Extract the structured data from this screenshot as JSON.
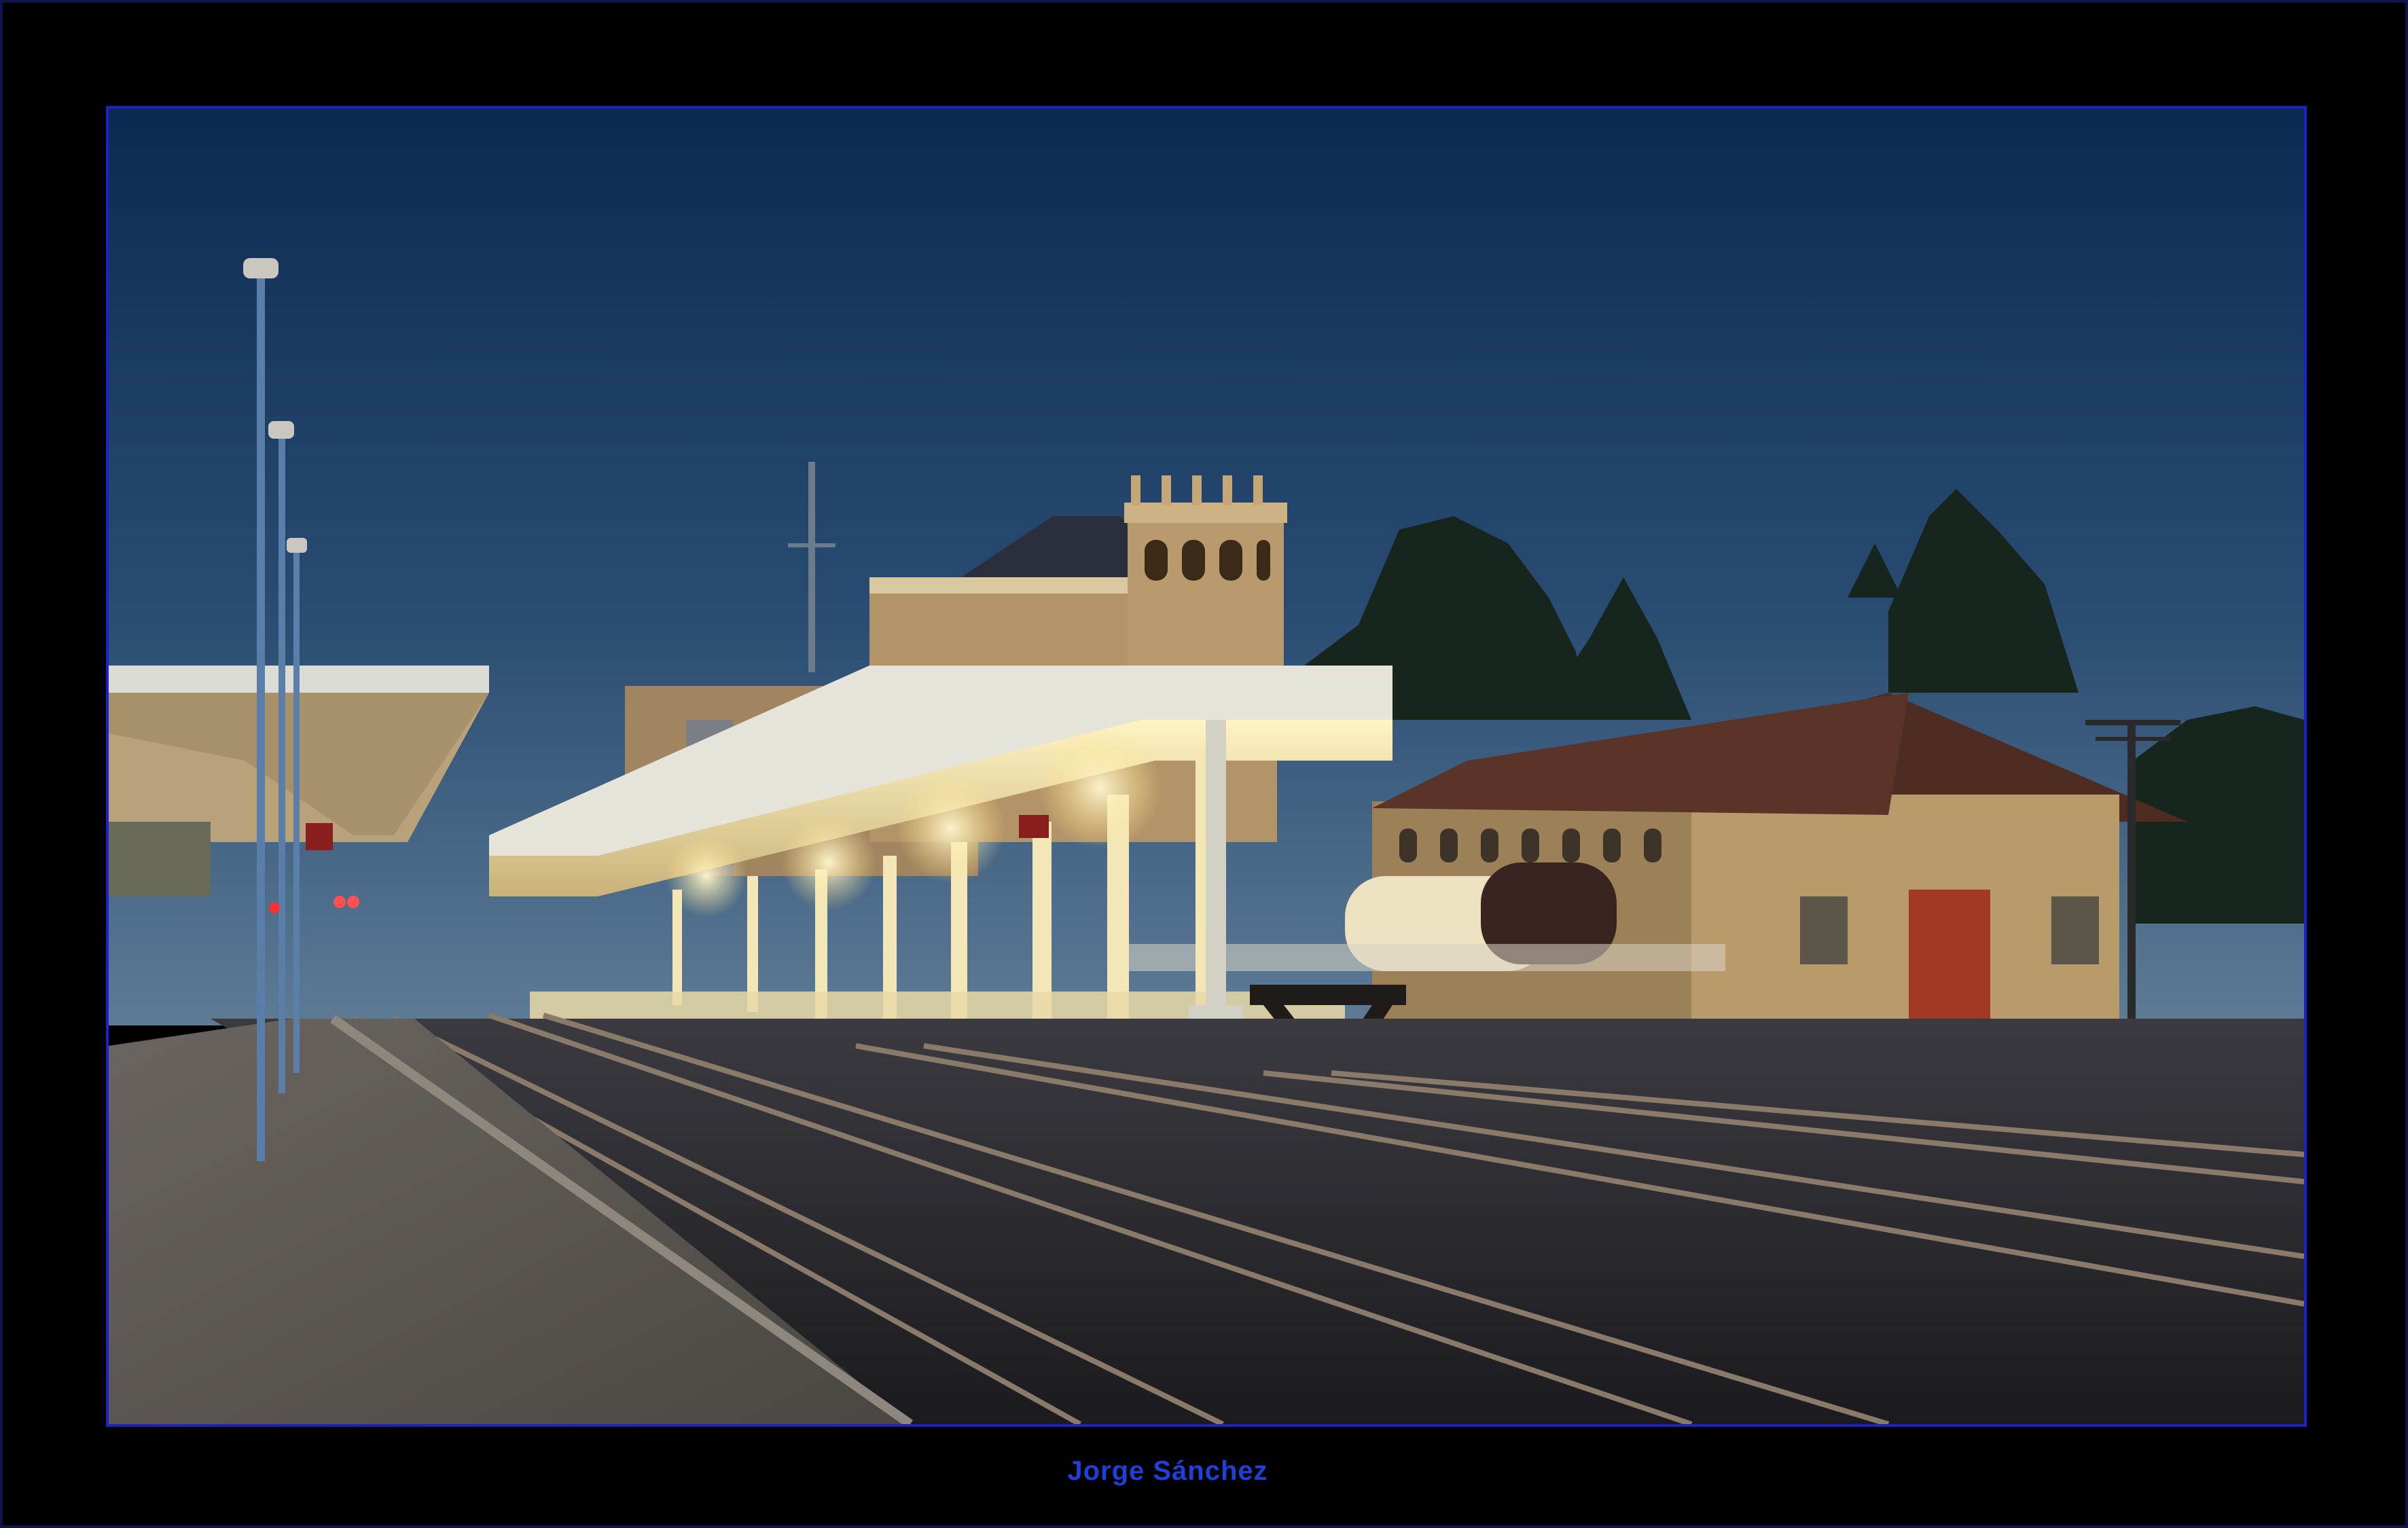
{
  "photo": {
    "subject": "railway-station-at-dusk",
    "colors": {
      "sky_top": "#0b2a52",
      "sky_bottom": "#4f6f8d",
      "warm_light": "#ffe9a6",
      "stone": "#b99a6a",
      "roof_tile": "#4e2c22",
      "frame_border": "#1a22c8"
    }
  },
  "caption": {
    "credit": "Jorge Sánchez",
    "color": "#1e40d8"
  }
}
